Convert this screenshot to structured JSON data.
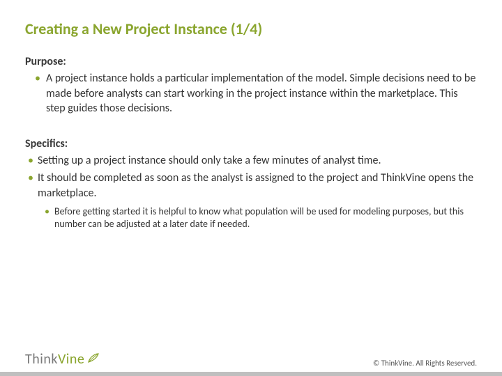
{
  "title": "Creating a New Project Instance (1/4)",
  "purpose": {
    "heading": "Purpose:",
    "items": [
      "A project instance holds a particular implementation of the model.  Simple decisions need to be made before analysts can start working in the project instance within the marketplace.  This step guides those decisions."
    ]
  },
  "specifics": {
    "heading": "Specifics:",
    "items": [
      "Setting up a project instance should only take a few minutes of analyst time.",
      "It should be completed as soon as the analyst is assigned to the project and ThinkVine opens the marketplace."
    ],
    "sub_items": [
      "Before getting started it is helpful to know what population will be used for modeling purposes, but this number can be adjusted at a later date if needed."
    ]
  },
  "footer": {
    "logo_think": "Think",
    "logo_vine": "Vine",
    "copyright": "© ThinkVine.  All Rights Reserved."
  }
}
